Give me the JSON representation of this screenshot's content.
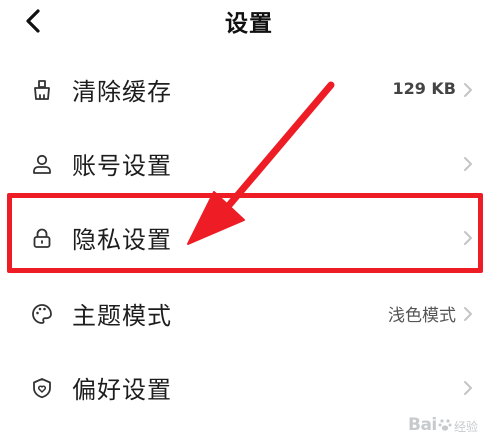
{
  "header": {
    "title": "设置",
    "back_icon": "chevron-left-icon"
  },
  "settings": [
    {
      "id": "clear-cache",
      "label": "清除缓存",
      "value": "129 KB",
      "icon": "broom-icon"
    },
    {
      "id": "account",
      "label": "账号设置",
      "value": "",
      "icon": "user-icon"
    },
    {
      "id": "privacy",
      "label": "隐私设置",
      "value": "",
      "icon": "lock-icon"
    },
    {
      "id": "theme",
      "label": "主题模式",
      "value": "浅色模式",
      "icon": "palette-icon"
    },
    {
      "id": "preference",
      "label": "偏好设置",
      "value": "",
      "icon": "heart-shield-icon"
    }
  ],
  "annotation": {
    "highlight_color": "#ee1c25",
    "highlighted_item": "隐私设置"
  },
  "watermark": {
    "logo_text": "Bai",
    "logo_suffix": "经验"
  },
  "colors": {
    "text": "#1d1d1d",
    "secondary": "#555555",
    "chevron": "#c4c4c4",
    "icon": "#333333",
    "accent": "#ee1c25"
  }
}
